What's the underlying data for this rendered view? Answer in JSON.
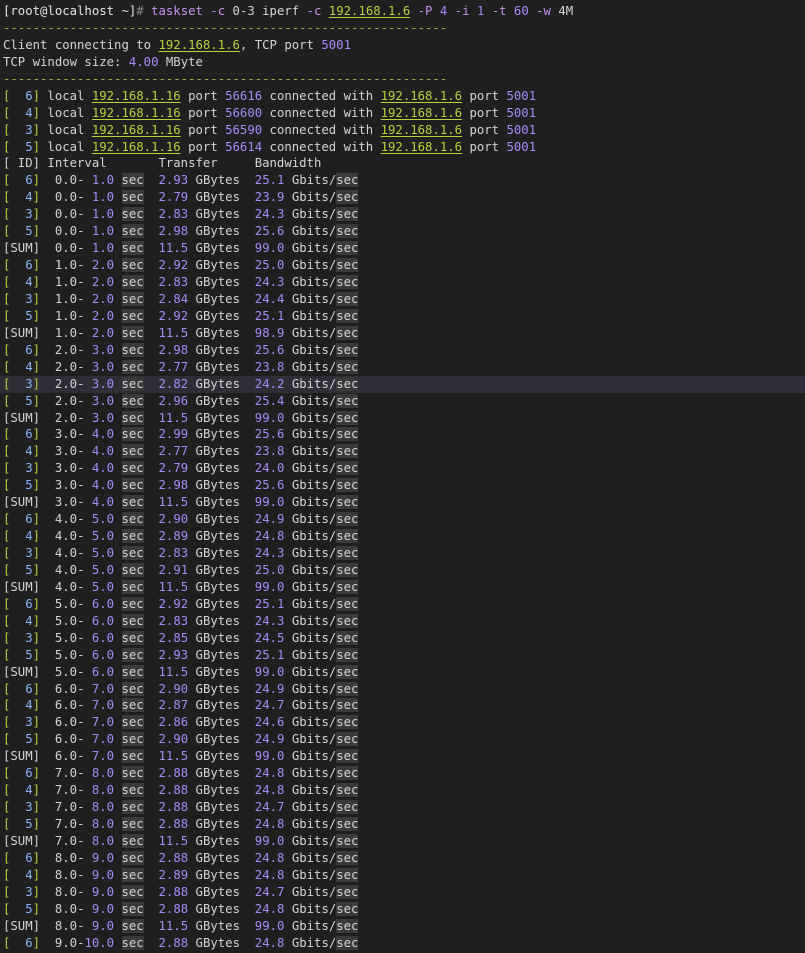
{
  "prompt": "[root@localhost ~]",
  "prompt_symbol": "#",
  "command": {
    "name": "taskset",
    "parts": [
      {
        "text": " -c ",
        "kind": "cmd"
      },
      {
        "text": "0-3",
        "kind": "plain"
      },
      {
        "text": " iperf ",
        "kind": "plain"
      },
      {
        "text": "-c ",
        "kind": "cmd"
      },
      {
        "text": "192.168.1.6",
        "kind": "ip"
      },
      {
        "text": " -P ",
        "kind": "cmd"
      },
      {
        "text": "4",
        "kind": "num"
      },
      {
        "text": " -i ",
        "kind": "cmd"
      },
      {
        "text": "1",
        "kind": "num"
      },
      {
        "text": " -t ",
        "kind": "cmd"
      },
      {
        "text": "60",
        "kind": "num"
      },
      {
        "text": " -w ",
        "kind": "cmd"
      },
      {
        "text": "4M",
        "kind": "plain"
      }
    ]
  },
  "separator": "------------------------------------------------------------",
  "client_line": {
    "prefix": "Client connecting to ",
    "host": "192.168.1.6",
    "mid": ", TCP port ",
    "port": "5001"
  },
  "window_line": {
    "prefix": "TCP window size: ",
    "size": "4.00",
    "unit": " MByte"
  },
  "connections": [
    {
      "id": "6",
      "local_ip": "192.168.1.16",
      "local_port": "56616",
      "remote_ip": "192.168.1.6",
      "remote_port": "5001"
    },
    {
      "id": "4",
      "local_ip": "192.168.1.16",
      "local_port": "56600",
      "remote_ip": "192.168.1.6",
      "remote_port": "5001"
    },
    {
      "id": "3",
      "local_ip": "192.168.1.16",
      "local_port": "56590",
      "remote_ip": "192.168.1.6",
      "remote_port": "5001"
    },
    {
      "id": "5",
      "local_ip": "192.168.1.16",
      "local_port": "56614",
      "remote_ip": "192.168.1.6",
      "remote_port": "5001"
    }
  ],
  "words": {
    "local": "local",
    "port": "port",
    "connected_with": "connected with"
  },
  "header": "[ ID] Interval       Transfer     Bandwidth",
  "units": {
    "sec": "sec",
    "transfer": "GBytes",
    "bw_prefix": "Gbits/",
    "bw_sec": "sec"
  },
  "highlight_row": 12,
  "rows": [
    {
      "id": "  6",
      "from": "0.0",
      "to": " 1.0",
      "transfer": "2.93",
      "bw": "25.1"
    },
    {
      "id": "  4",
      "from": "0.0",
      "to": " 1.0",
      "transfer": "2.79",
      "bw": "23.9"
    },
    {
      "id": "  3",
      "from": "0.0",
      "to": " 1.0",
      "transfer": "2.83",
      "bw": "24.3"
    },
    {
      "id": "  5",
      "from": "0.0",
      "to": " 1.0",
      "transfer": "2.98",
      "bw": "25.6"
    },
    {
      "id": "SUM",
      "from": "0.0",
      "to": " 1.0",
      "transfer": "11.5",
      "bw": "99.0"
    },
    {
      "id": "  6",
      "from": "1.0",
      "to": " 2.0",
      "transfer": "2.92",
      "bw": "25.0"
    },
    {
      "id": "  4",
      "from": "1.0",
      "to": " 2.0",
      "transfer": "2.83",
      "bw": "24.3"
    },
    {
      "id": "  3",
      "from": "1.0",
      "to": " 2.0",
      "transfer": "2.84",
      "bw": "24.4"
    },
    {
      "id": "  5",
      "from": "1.0",
      "to": " 2.0",
      "transfer": "2.92",
      "bw": "25.1"
    },
    {
      "id": "SUM",
      "from": "1.0",
      "to": " 2.0",
      "transfer": "11.5",
      "bw": "98.9"
    },
    {
      "id": "  6",
      "from": "2.0",
      "to": " 3.0",
      "transfer": "2.98",
      "bw": "25.6"
    },
    {
      "id": "  4",
      "from": "2.0",
      "to": " 3.0",
      "transfer": "2.77",
      "bw": "23.8"
    },
    {
      "id": "  3",
      "from": "2.0",
      "to": " 3.0",
      "transfer": "2.82",
      "bw": "24.2"
    },
    {
      "id": "  5",
      "from": "2.0",
      "to": " 3.0",
      "transfer": "2.96",
      "bw": "25.4"
    },
    {
      "id": "SUM",
      "from": "2.0",
      "to": " 3.0",
      "transfer": "11.5",
      "bw": "99.0"
    },
    {
      "id": "  6",
      "from": "3.0",
      "to": " 4.0",
      "transfer": "2.99",
      "bw": "25.6"
    },
    {
      "id": "  4",
      "from": "3.0",
      "to": " 4.0",
      "transfer": "2.77",
      "bw": "23.8"
    },
    {
      "id": "  3",
      "from": "3.0",
      "to": " 4.0",
      "transfer": "2.79",
      "bw": "24.0"
    },
    {
      "id": "  5",
      "from": "3.0",
      "to": " 4.0",
      "transfer": "2.98",
      "bw": "25.6"
    },
    {
      "id": "SUM",
      "from": "3.0",
      "to": " 4.0",
      "transfer": "11.5",
      "bw": "99.0"
    },
    {
      "id": "  6",
      "from": "4.0",
      "to": " 5.0",
      "transfer": "2.90",
      "bw": "24.9"
    },
    {
      "id": "  4",
      "from": "4.0",
      "to": " 5.0",
      "transfer": "2.89",
      "bw": "24.8"
    },
    {
      "id": "  3",
      "from": "4.0",
      "to": " 5.0",
      "transfer": "2.83",
      "bw": "24.3"
    },
    {
      "id": "  5",
      "from": "4.0",
      "to": " 5.0",
      "transfer": "2.91",
      "bw": "25.0"
    },
    {
      "id": "SUM",
      "from": "4.0",
      "to": " 5.0",
      "transfer": "11.5",
      "bw": "99.0"
    },
    {
      "id": "  6",
      "from": "5.0",
      "to": " 6.0",
      "transfer": "2.92",
      "bw": "25.1"
    },
    {
      "id": "  4",
      "from": "5.0",
      "to": " 6.0",
      "transfer": "2.83",
      "bw": "24.3"
    },
    {
      "id": "  3",
      "from": "5.0",
      "to": " 6.0",
      "transfer": "2.85",
      "bw": "24.5"
    },
    {
      "id": "  5",
      "from": "5.0",
      "to": " 6.0",
      "transfer": "2.93",
      "bw": "25.1"
    },
    {
      "id": "SUM",
      "from": "5.0",
      "to": " 6.0",
      "transfer": "11.5",
      "bw": "99.0"
    },
    {
      "id": "  6",
      "from": "6.0",
      "to": " 7.0",
      "transfer": "2.90",
      "bw": "24.9"
    },
    {
      "id": "  4",
      "from": "6.0",
      "to": " 7.0",
      "transfer": "2.87",
      "bw": "24.7"
    },
    {
      "id": "  3",
      "from": "6.0",
      "to": " 7.0",
      "transfer": "2.86",
      "bw": "24.6"
    },
    {
      "id": "  5",
      "from": "6.0",
      "to": " 7.0",
      "transfer": "2.90",
      "bw": "24.9"
    },
    {
      "id": "SUM",
      "from": "6.0",
      "to": " 7.0",
      "transfer": "11.5",
      "bw": "99.0"
    },
    {
      "id": "  6",
      "from": "7.0",
      "to": " 8.0",
      "transfer": "2.88",
      "bw": "24.8"
    },
    {
      "id": "  4",
      "from": "7.0",
      "to": " 8.0",
      "transfer": "2.88",
      "bw": "24.8"
    },
    {
      "id": "  3",
      "from": "7.0",
      "to": " 8.0",
      "transfer": "2.88",
      "bw": "24.7"
    },
    {
      "id": "  5",
      "from": "7.0",
      "to": " 8.0",
      "transfer": "2.88",
      "bw": "24.8"
    },
    {
      "id": "SUM",
      "from": "7.0",
      "to": " 8.0",
      "transfer": "11.5",
      "bw": "99.0"
    },
    {
      "id": "  6",
      "from": "8.0",
      "to": " 9.0",
      "transfer": "2.88",
      "bw": "24.8"
    },
    {
      "id": "  4",
      "from": "8.0",
      "to": " 9.0",
      "transfer": "2.89",
      "bw": "24.8"
    },
    {
      "id": "  3",
      "from": "8.0",
      "to": " 9.0",
      "transfer": "2.88",
      "bw": "24.7"
    },
    {
      "id": "  5",
      "from": "8.0",
      "to": " 9.0",
      "transfer": "2.88",
      "bw": "24.8"
    },
    {
      "id": "SUM",
      "from": "8.0",
      "to": " 9.0",
      "transfer": "11.5",
      "bw": "99.0"
    },
    {
      "id": "  6",
      "from": "9.0",
      "to": "10.0",
      "transfer": "2.88",
      "bw": "24.8"
    }
  ]
}
